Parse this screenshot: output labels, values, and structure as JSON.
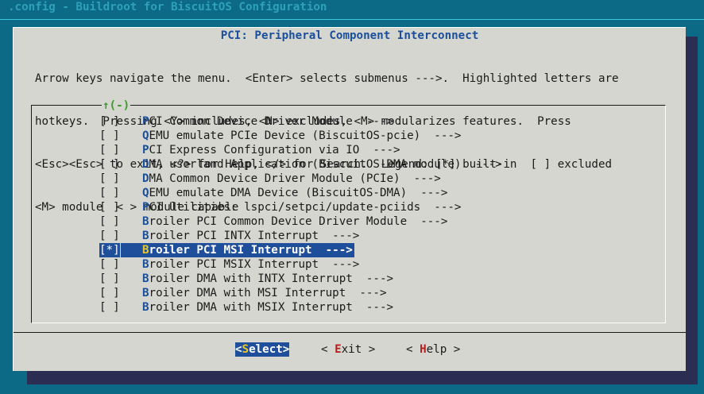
{
  "window": {
    "backtitle": ".config - Buildroot for BiscuitOS Configuration"
  },
  "dialog": {
    "title": "PCI: Peripheral Component Interconnect",
    "help_lines": [
      "Arrow keys navigate the menu.  <Enter> selects submenus --->.  Highlighted letters are",
      "hotkeys.  Pressing <Y> includes, <N> excludes, <M> modularizes features.  Press",
      "<Esc><Esc> to exit, <?> for Help, </> for Search.  Legend: [*] built-in  [ ] excluded",
      "<M> module  < > module capable"
    ],
    "scroll_indicator": "↑(-)"
  },
  "menu": {
    "items": [
      {
        "box": "[ ]",
        "hot": "P",
        "rest": "CI Common Device Driver Module  --->"
      },
      {
        "box": "[ ]",
        "hot": "Q",
        "rest": "EMU emulate PCIe Device (BiscuitOS-pcie)  --->"
      },
      {
        "box": "[ ]",
        "hot": "P",
        "rest": "CI Express Configuration via IO  --->"
      },
      {
        "box": "[ ]",
        "hot": "D",
        "rest": "MA userland Application (BiscuitOS-DMA module)  --->"
      },
      {
        "box": "[ ]",
        "hot": "D",
        "rest": "MA Common Device Driver Module (PCIe)  --->"
      },
      {
        "box": "[ ]",
        "hot": "Q",
        "rest": "EMU emulate DMA Device (BiscuitOS-DMA)  --->"
      },
      {
        "box": "[ ]",
        "hot": "P",
        "rest": "CI Utilities: lspci/setpci/update-pciids  --->"
      },
      {
        "box": "[ ]",
        "hot": "B",
        "rest": "roiler PCI Common Device Driver Module  --->"
      },
      {
        "box": "[ ]",
        "hot": "B",
        "rest": "roiler PCI INTX Interrupt  --->"
      },
      {
        "box": "[*]",
        "hot": "B",
        "rest": "roiler PCI MSI Interrupt  --->"
      },
      {
        "box": "[ ]",
        "hot": "B",
        "rest": "roiler PCI MSIX Interrupt  --->"
      },
      {
        "box": "[ ]",
        "hot": "B",
        "rest": "roiler DMA with INTX Interrupt  --->"
      },
      {
        "box": "[ ]",
        "hot": "B",
        "rest": "roiler DMA with MSI Interrupt  --->"
      },
      {
        "box": "[ ]",
        "hot": "B",
        "rest": "roiler DMA with MSIX Interrupt  --->"
      }
    ],
    "selected_index": 9
  },
  "buttons": {
    "select": {
      "pre": "<",
      "hot": "S",
      "post": "elect>"
    },
    "exit": {
      "pre": "< ",
      "hot": "E",
      "post": "xit >"
    },
    "help": {
      "pre": "< ",
      "hot": "H",
      "post": "elp >"
    }
  },
  "colors": {
    "background": "#0c6a86",
    "dialog": "#d6d6d0",
    "title": "#1a4f9c",
    "selection": "#1f4f9a",
    "hotkey_selected": "#e8c82a",
    "button_hotkey": "#b42020"
  }
}
